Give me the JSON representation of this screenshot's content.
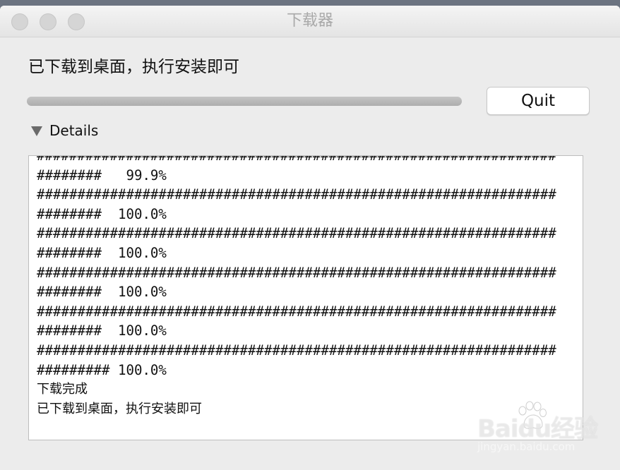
{
  "window": {
    "title": "下载器"
  },
  "message": "已下载到桌面，执行安装即可",
  "progress": {
    "fraction": 1.0
  },
  "buttons": {
    "quit_label": "Quit"
  },
  "details": {
    "label": "Details",
    "expanded": true
  },
  "log": {
    "lines": [
      "################################################################",
      "########   99.9%",
      "################################################################",
      "########  100.0%",
      "################################################################",
      "########  100.0%",
      "################################################################",
      "########  100.0%",
      "################################################################",
      "########  100.0%",
      "################################################################",
      "######### 100.0%"
    ],
    "status_lines": [
      "下载完成",
      "已下载到桌面，执行安装即可"
    ]
  },
  "watermark": {
    "brand": "Baidu经验",
    "url": "jingyan.baidu.com"
  }
}
